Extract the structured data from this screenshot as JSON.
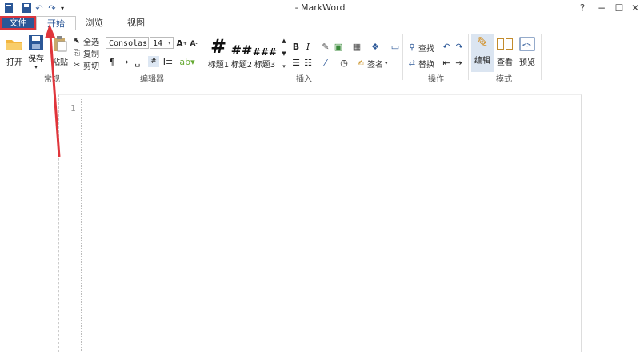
{
  "window": {
    "title": "-  MarkWord"
  },
  "tabs": {
    "file": "文件",
    "home": "开始",
    "browse": "浏览",
    "view": "视图"
  },
  "groups": {
    "common": {
      "label": "常规",
      "open": "打开",
      "save": "保存",
      "paste": "粘贴",
      "select_all": "全选",
      "copy": "复制",
      "cut": "剪切"
    },
    "editor": {
      "label": "编辑器",
      "font": "Consolas",
      "size": "14"
    },
    "insert": {
      "label": "插入",
      "h1": "标题1",
      "h2": "标题2",
      "h3": "标题3",
      "signature": "签名"
    },
    "actions": {
      "label": "操作",
      "find": "查找",
      "replace": "替换"
    },
    "mode": {
      "label": "模式",
      "edit": "编辑",
      "view": "查看",
      "preview": "预览"
    }
  },
  "editor": {
    "line_number": "1"
  },
  "colors": {
    "file_tab": "#2b5797",
    "highlight_box": "#d9363e",
    "arrow": "#e0353b"
  }
}
